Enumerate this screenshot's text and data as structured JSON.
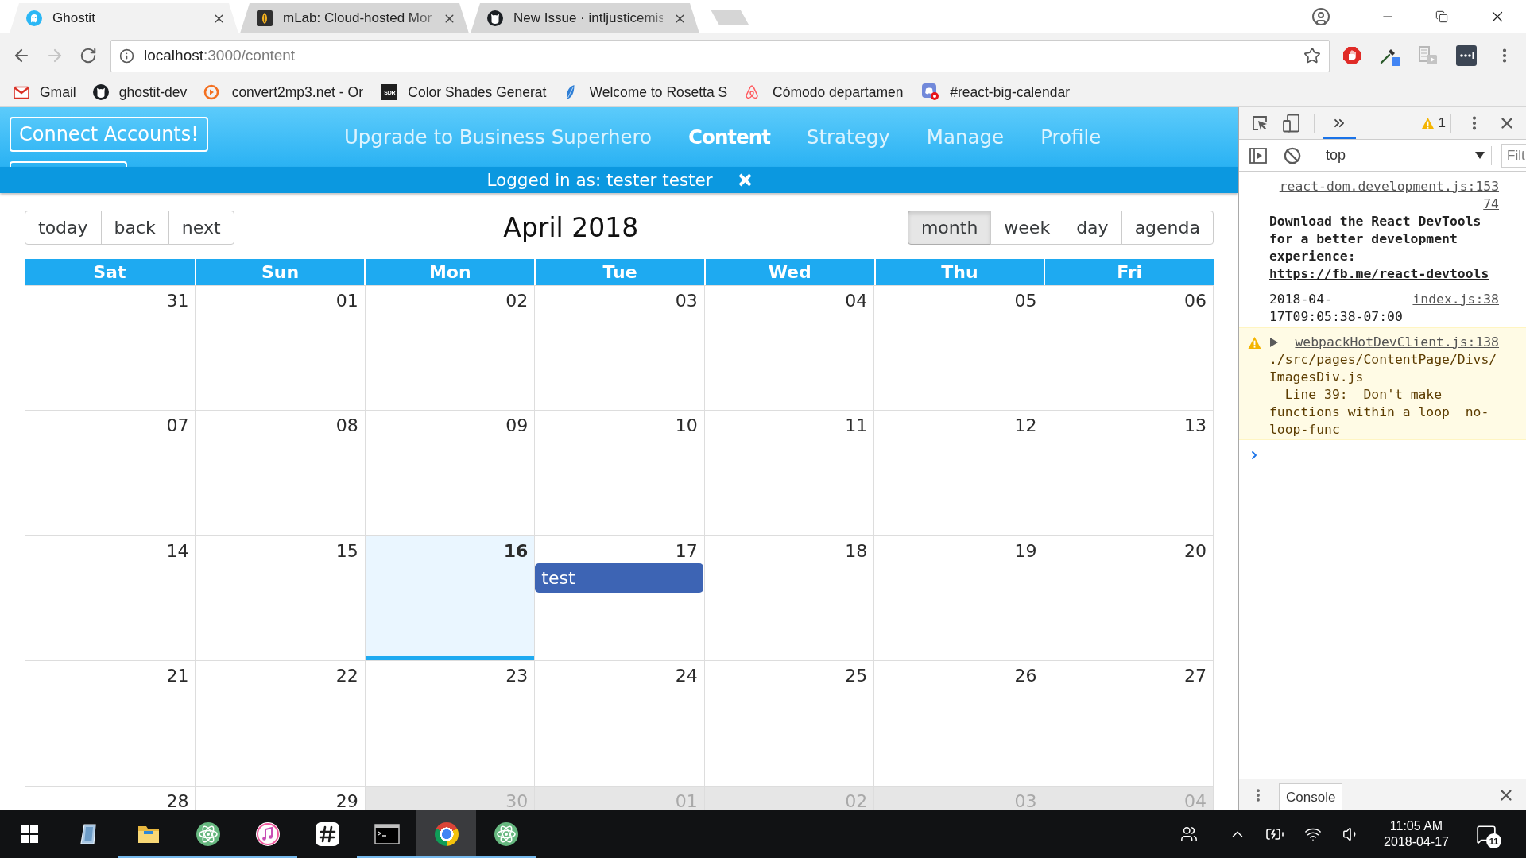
{
  "browser": {
    "tabs": [
      {
        "title": "Ghostit",
        "selected": true,
        "truncated": false
      },
      {
        "title": "mLab: Cloud-hosted Mor",
        "selected": false,
        "truncated": true
      },
      {
        "title": "New Issue · intljusticemis",
        "selected": false,
        "truncated": true
      }
    ],
    "navigation": {
      "back_disabled": false,
      "forward_disabled": true
    },
    "address": {
      "host": "localhost",
      "path": ":3000/content"
    },
    "bookmarks": [
      {
        "label": "Gmail",
        "truncated": false
      },
      {
        "label": "ghostit-dev",
        "truncated": false
      },
      {
        "label": "convert2mp3.net - Or",
        "truncated": true
      },
      {
        "label": "Color Shades Generat",
        "truncated": true,
        "icon_text": "SDR"
      },
      {
        "label": "Welcome to Rosetta S",
        "truncated": true
      },
      {
        "label": "Cómodo departamen",
        "truncated": true
      },
      {
        "label": "#react-big-calendar",
        "truncated": false
      }
    ]
  },
  "nav": {
    "connect_button": "Connect Accounts!",
    "links": [
      {
        "label": "Upgrade to Business Superhero",
        "selected": false
      },
      {
        "label": "Content",
        "selected": true
      },
      {
        "label": "Strategy",
        "selected": false
      },
      {
        "label": "Manage",
        "selected": false
      },
      {
        "label": "Profile",
        "selected": false
      }
    ]
  },
  "login_banner": {
    "text": "Logged in as: tester tester"
  },
  "calendar": {
    "nav_buttons": [
      "today",
      "back",
      "next"
    ],
    "title": "April 2018",
    "views": [
      {
        "label": "month",
        "selected": true
      },
      {
        "label": "week",
        "selected": false
      },
      {
        "label": "day",
        "selected": false
      },
      {
        "label": "agenda",
        "selected": false
      }
    ],
    "weekdays": [
      "Sat",
      "Sun",
      "Mon",
      "Tue",
      "Wed",
      "Thu",
      "Fri"
    ],
    "weeks": [
      [
        {
          "date": "31",
          "today": false,
          "off_range": false
        },
        {
          "date": "01",
          "today": false,
          "off_range": false
        },
        {
          "date": "02",
          "today": false,
          "off_range": false
        },
        {
          "date": "03",
          "today": false,
          "off_range": false
        },
        {
          "date": "04",
          "today": false,
          "off_range": false
        },
        {
          "date": "05",
          "today": false,
          "off_range": false
        },
        {
          "date": "06",
          "today": false,
          "off_range": false
        }
      ],
      [
        {
          "date": "07",
          "today": false,
          "off_range": false
        },
        {
          "date": "08",
          "today": false,
          "off_range": false
        },
        {
          "date": "09",
          "today": false,
          "off_range": false
        },
        {
          "date": "10",
          "today": false,
          "off_range": false
        },
        {
          "date": "11",
          "today": false,
          "off_range": false
        },
        {
          "date": "12",
          "today": false,
          "off_range": false
        },
        {
          "date": "13",
          "today": false,
          "off_range": false
        }
      ],
      [
        {
          "date": "14",
          "today": false,
          "off_range": false
        },
        {
          "date": "15",
          "today": false,
          "off_range": false
        },
        {
          "date": "16",
          "today": true,
          "off_range": false
        },
        {
          "date": "17",
          "today": false,
          "off_range": false,
          "event": "test"
        },
        {
          "date": "18",
          "today": false,
          "off_range": false
        },
        {
          "date": "19",
          "today": false,
          "off_range": false
        },
        {
          "date": "20",
          "today": false,
          "off_range": false
        }
      ],
      [
        {
          "date": "21",
          "today": false,
          "off_range": false
        },
        {
          "date": "22",
          "today": false,
          "off_range": false
        },
        {
          "date": "23",
          "today": false,
          "off_range": false
        },
        {
          "date": "24",
          "today": false,
          "off_range": false
        },
        {
          "date": "25",
          "today": false,
          "off_range": false
        },
        {
          "date": "26",
          "today": false,
          "off_range": false
        },
        {
          "date": "27",
          "today": false,
          "off_range": false
        }
      ],
      [
        {
          "date": "28",
          "today": false,
          "off_range": false
        },
        {
          "date": "29",
          "today": false,
          "off_range": false
        },
        {
          "date": "30",
          "today": false,
          "off_range": true
        },
        {
          "date": "01",
          "today": false,
          "off_range": true
        },
        {
          "date": "02",
          "today": false,
          "off_range": true
        },
        {
          "date": "03",
          "today": false,
          "off_range": true
        },
        {
          "date": "04",
          "today": false,
          "off_range": true
        }
      ]
    ]
  },
  "devtools": {
    "more_tabs": {
      "selected": true
    },
    "warning_count": "1",
    "context": "top",
    "filter_placeholder": "Filt",
    "messages": [
      {
        "kind": "log",
        "bold": true,
        "source": "react-dom.development.js:15374",
        "text": "Download the React DevTools for a better development experience:",
        "link": "https://fb.me/react-devtools"
      },
      {
        "kind": "log",
        "bold": false,
        "source": "index.js:38",
        "text": "2018-04-17T09:05:38-07:00"
      },
      {
        "kind": "warning",
        "bold": false,
        "expanded": false,
        "source": "webpackHotDevClient.js:138",
        "text": "./src/pages/ContentPage/Divs/ImagesDiv.js\n  Line 39:  Don't make functions within a loop  no-loop-func"
      }
    ],
    "drawer_tabs": [
      {
        "label": "Console",
        "selected": true
      }
    ]
  },
  "taskbar": {
    "apps": [
      {
        "running": false,
        "selected": false
      },
      {
        "running": true,
        "selected": false
      },
      {
        "running": true,
        "selected": false
      },
      {
        "running": true,
        "selected": false
      },
      {
        "running": false,
        "selected": false
      },
      {
        "running": true,
        "selected": false
      },
      {
        "running": true,
        "selected": true
      },
      {
        "running": true,
        "selected": false
      }
    ],
    "clock": {
      "time": "11:05 AM",
      "date": "2018-04-17"
    },
    "notification_count": "11"
  }
}
